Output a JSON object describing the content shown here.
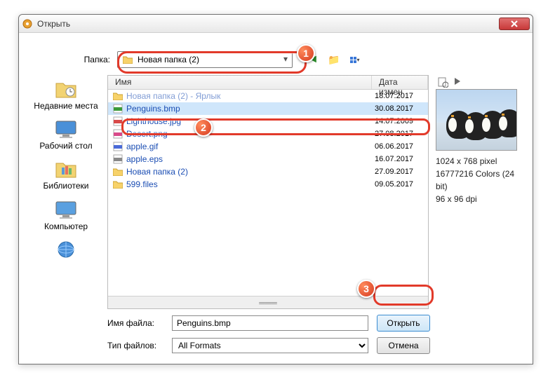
{
  "window": {
    "title": "Открыть"
  },
  "folderRow": {
    "label": "Папка:",
    "current": "Новая папка (2)"
  },
  "columns": {
    "name": "Имя",
    "date": "Дата измен"
  },
  "files": [
    {
      "name": "Новая папка (2) - Ярлык",
      "date": "18.07.2017",
      "icon": "folder",
      "selected": false,
      "blur": true
    },
    {
      "name": "Penguins.bmp",
      "date": "30.08.2017",
      "icon": "bmp",
      "selected": true,
      "blur": false
    },
    {
      "name": "Lighthouse.jpg",
      "date": "14.07.2009",
      "icon": "jpg",
      "selected": false,
      "blur": false
    },
    {
      "name": "Desert.png",
      "date": "27.08.2017",
      "icon": "png",
      "selected": false,
      "blur": false
    },
    {
      "name": "apple.gif",
      "date": "06.06.2017",
      "icon": "gif",
      "selected": false,
      "blur": false
    },
    {
      "name": "apple.eps",
      "date": "16.07.2017",
      "icon": "eps",
      "selected": false,
      "blur": false
    },
    {
      "name": "Новая папка (2)",
      "date": "27.09.2017",
      "icon": "folder",
      "selected": false,
      "blur": false
    },
    {
      "name": "599.files",
      "date": "09.05.2017",
      "icon": "folder",
      "selected": false,
      "blur": false
    }
  ],
  "places": [
    {
      "label": "Недавние места",
      "icon": "recent"
    },
    {
      "label": "Рабочий стол",
      "icon": "desktop"
    },
    {
      "label": "Библиотеки",
      "icon": "libraries"
    },
    {
      "label": "Компьютер",
      "icon": "computer"
    },
    {
      "label": "",
      "icon": "network"
    }
  ],
  "preview": {
    "dimensions": "1024 x 768 pixel",
    "colors": "16777216 Colors (24 bit)",
    "dpi": "96 x 96 dpi"
  },
  "bottom": {
    "fileLabel": "Имя файла:",
    "fileName": "Penguins.bmp",
    "typeLabel": "Тип файлов:",
    "typeValue": "All Formats",
    "open": "Открыть",
    "cancel": "Отмена"
  },
  "badges": {
    "b1": "1",
    "b2": "2",
    "b3": "3"
  }
}
